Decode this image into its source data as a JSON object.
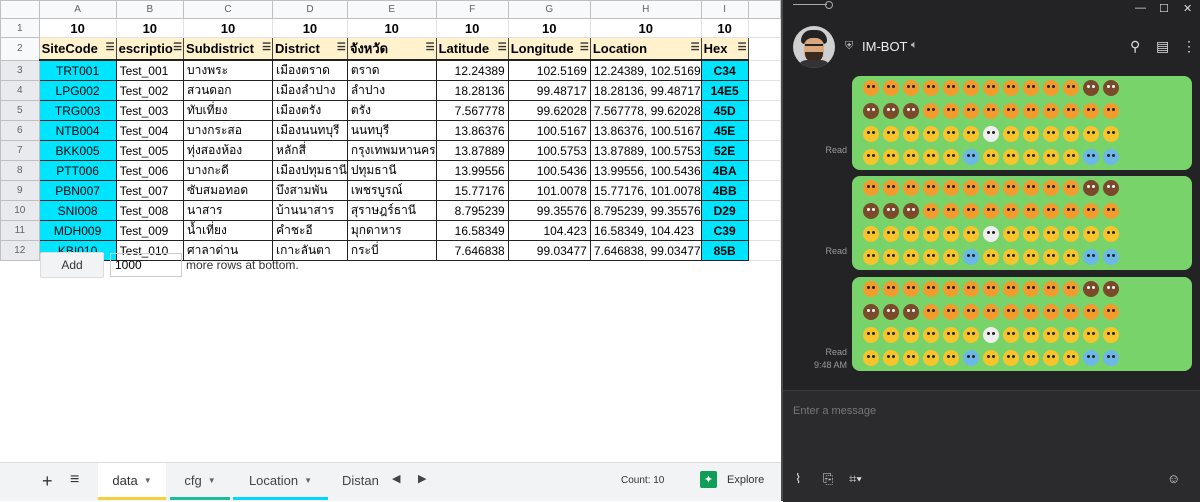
{
  "sheet": {
    "col_letters": [
      "A",
      "B",
      "C",
      "D",
      "E",
      "F",
      "G",
      "H",
      "I"
    ],
    "row_numbers": [
      "1",
      "2",
      "3",
      "4",
      "5",
      "6",
      "7",
      "8",
      "9",
      "10",
      "11",
      "12"
    ],
    "row1_values": [
      "10",
      "10",
      "10",
      "10",
      "10",
      "10",
      "10",
      "10",
      "10"
    ],
    "headers": [
      "SiteCode",
      "escriptio",
      "Subdistrict",
      "District",
      "จังหวัด",
      "Latitude",
      "Longitude",
      "Location",
      "Hex"
    ],
    "rows": [
      [
        "TRT001",
        "Test_001",
        "บางพระ",
        "เมืองตราด",
        "ตราด",
        "12.24389",
        "102.5169",
        "12.24389, 102.5169",
        "C34"
      ],
      [
        "LPG002",
        "Test_002",
        "สวนดอก",
        "เมืองลำปาง",
        "ลำปาง",
        "18.28136",
        "99.48717",
        "18.28136, 99.48717",
        "14E5"
      ],
      [
        "TRG003",
        "Test_003",
        "ทับเที่ยง",
        "เมืองตรัง",
        "ตรัง",
        "7.567778",
        "99.62028",
        "7.567778, 99.62028",
        "45D"
      ],
      [
        "NTB004",
        "Test_004",
        "บางกระสอ",
        "เมืองนนทบุรี",
        "นนทบุรี",
        "13.86376",
        "100.5167",
        "13.86376, 100.5167",
        "45E"
      ],
      [
        "BKK005",
        "Test_005",
        "ทุ่งสองห้อง",
        "หลักสี่",
        "กรุงเทพมหานคร",
        "13.87889",
        "100.5753",
        "13.87889, 100.5753",
        "52E"
      ],
      [
        "PTT006",
        "Test_006",
        "บางกะดี",
        "เมืองปทุมธานี",
        "ปทุมธานี",
        "13.99556",
        "100.5436",
        "13.99556, 100.5436",
        "4BA"
      ],
      [
        "PBN007",
        "Test_007",
        "ซับสมอทอด",
        "บึงสามพัน",
        "เพชรบูรณ์",
        "15.77176",
        "101.0078",
        "15.77176, 101.0078",
        "4BB"
      ],
      [
        "SNI008",
        "Test_008",
        "นาสาร",
        "บ้านนาสาร",
        "สุราษฎร์ธานี",
        "8.795239",
        "99.35576",
        "8.795239, 99.35576",
        "D29"
      ],
      [
        "MDH009",
        "Test_009",
        "น้ำเที่ยง",
        "คำชะอี",
        "มุกดาหาร",
        "16.58349",
        "104.423",
        "16.58349, 104.423",
        "C39"
      ],
      [
        "KBI010",
        "Test_010",
        "ศาลาด่าน",
        "เกาะลันตา",
        "กระบี่",
        "7.646838",
        "99.03477",
        "7.646838, 99.03477",
        "85B"
      ]
    ],
    "add_button": "Add",
    "add_count": "1000",
    "add_label": "more rows at bottom.",
    "tabs": [
      {
        "label": "data",
        "color": "#f4d03f"
      },
      {
        "label": "cfg",
        "color": "#1abc9c"
      },
      {
        "label": "Location",
        "color": "#00d8ff"
      },
      {
        "label": "Distan"
      }
    ],
    "count_label": "Count: 10",
    "explore_label": "Explore"
  },
  "chat": {
    "contact_name": "IM-BOT",
    "messages": [
      {
        "status": "Read"
      },
      {
        "status": "Read"
      },
      {
        "status": "Read",
        "time": "9:48 AM"
      }
    ],
    "placeholder": "Enter a message",
    "window_buttons": [
      "—",
      "☐",
      "✕"
    ]
  }
}
